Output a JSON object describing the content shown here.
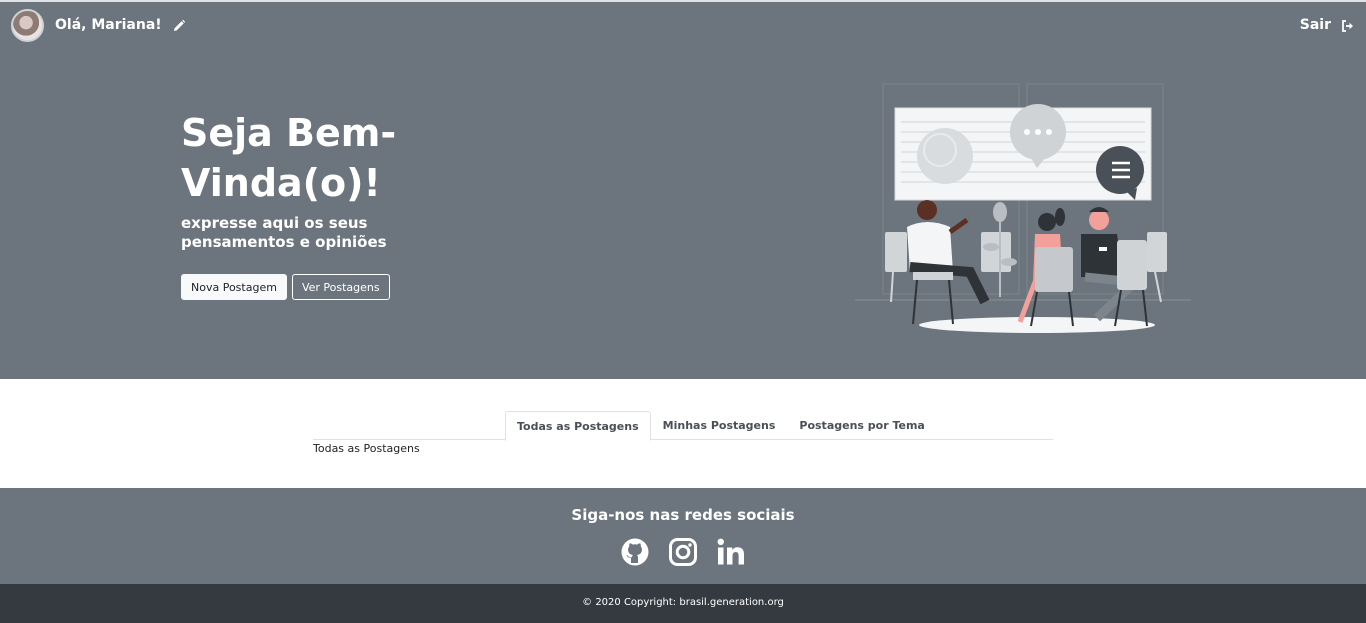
{
  "nav": {
    "greeting": "Olá, Mariana!",
    "logout_label": "Sair",
    "avatar_icon": "user-avatar",
    "edit_icon": "pencil-icon",
    "logout_icon": "sign-out-icon"
  },
  "hero": {
    "title": "Seja Bem-Vinda(o)!",
    "subtitle": "expresse aqui os seus pensamentos e opiniões",
    "new_post_button": "Nova Postagem",
    "view_posts_button": "Ver Postagens"
  },
  "tabs": {
    "items": [
      {
        "label": "Todas as Postagens",
        "active": true
      },
      {
        "label": "Minhas Postagens",
        "active": false
      },
      {
        "label": "Postagens por Tema",
        "active": false
      }
    ],
    "content": "Todas as Postagens"
  },
  "footer": {
    "title": "Siga-nos nas redes sociais",
    "social_icons": [
      "github-icon",
      "instagram-icon",
      "linkedin-icon"
    ],
    "copyright": "© 2020 Copyright: brasil.generation.org"
  },
  "colors": {
    "hero_bg": "#6c757d",
    "copyright_bg": "#343a40",
    "text_light": "#ffffff"
  }
}
